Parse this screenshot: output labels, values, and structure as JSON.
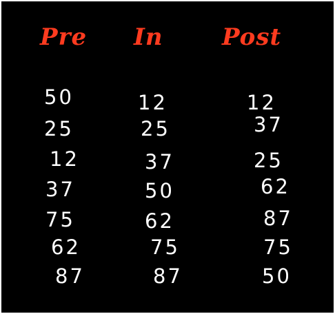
{
  "colors": {
    "background": "#000000",
    "heading": "#ff3b1f",
    "value": "#ffffff"
  },
  "columns": [
    {
      "heading": "Pre",
      "values": [
        "50",
        "25",
        "12",
        "37",
        "75",
        "62",
        "87"
      ]
    },
    {
      "heading": "In",
      "values": [
        "12",
        "25",
        "37",
        "50",
        "62",
        "75",
        "87"
      ]
    },
    {
      "heading": "Post",
      "values": [
        "12",
        "37",
        "25",
        "62",
        "87",
        "75",
        "50"
      ]
    }
  ]
}
